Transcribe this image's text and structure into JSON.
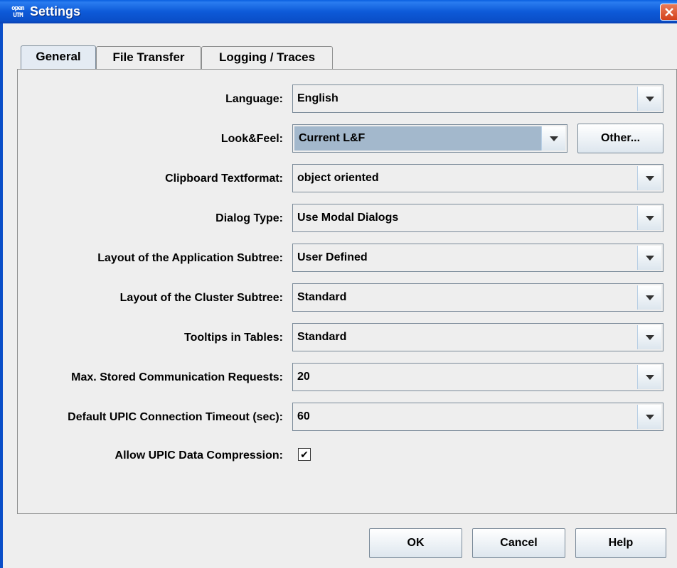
{
  "window": {
    "title": "Settings",
    "app_icon": "openUTM-icon"
  },
  "tabs": [
    {
      "label": "General",
      "active": true
    },
    {
      "label": "File Transfer",
      "active": false
    },
    {
      "label": "Logging / Traces",
      "active": false
    }
  ],
  "general": {
    "language": {
      "label": "Language:",
      "value": "English"
    },
    "lookfeel": {
      "label": "Look&Feel:",
      "value": "Current L&F",
      "button": "Other..."
    },
    "clipboard": {
      "label": "Clipboard Textformat:",
      "value": "object oriented"
    },
    "dialog_type": {
      "label": "Dialog Type:",
      "value": "Use Modal Dialogs"
    },
    "app_subtree": {
      "label": "Layout of the Application Subtree:",
      "value": "User Defined"
    },
    "cluster_subtree": {
      "label": "Layout of the Cluster Subtree:",
      "value": "Standard"
    },
    "tooltips": {
      "label": "Tooltips in Tables:",
      "value": "Standard"
    },
    "max_requests": {
      "label": "Max. Stored Communication Requests:",
      "value": "20"
    },
    "timeout": {
      "label": "Default UPIC Connection Timeout (sec):",
      "value": "60"
    },
    "compression": {
      "label": "Allow UPIC Data Compression:",
      "checked": true,
      "check_glyph": "✔"
    }
  },
  "buttons": {
    "ok": "OK",
    "cancel": "Cancel",
    "help": "Help"
  },
  "colors": {
    "titlebar": "#0a5fe0",
    "selected_field": "#a3b8cc",
    "close_button": "#d4411b"
  }
}
